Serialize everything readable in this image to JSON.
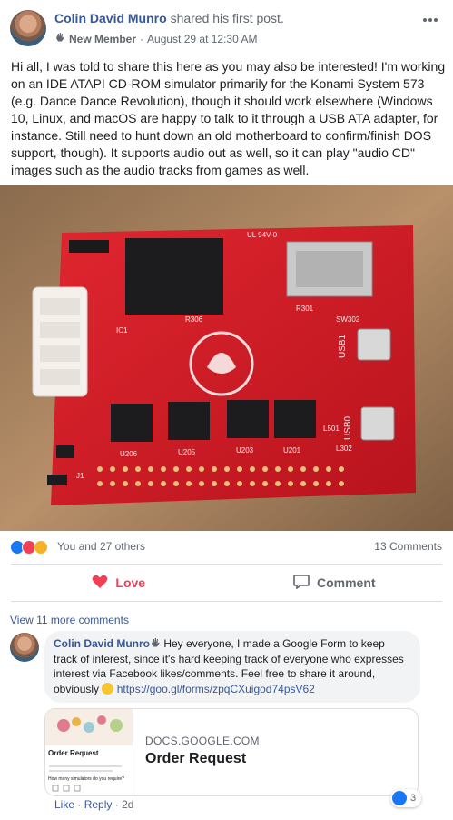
{
  "post": {
    "author": "Colin David Munro",
    "action": "shared his first post.",
    "badge": "New Member",
    "separator": "·",
    "timestamp": "August 29 at 12:30 AM",
    "text": "Hi all, I was told to share this here as you may also be interested! I'm working on an IDE ATAPI CD-ROM simulator primarily for the Konami System 573 (e.g. Dance Dance Revolution), though it should work elsewhere (Windows 10, Linux, and macOS are happy to talk to it through a USB ATA adapter, for instance. Still need to hunt down an old motherboard to confirm/finish DOS support, though). It supports audio out as well, so it can play \"audio CD\" images such as the audio tracks from games as well."
  },
  "photo": {
    "board_labels": {
      "ul": "UL 94V-0",
      "ic": "IC1",
      "sw": "SW302",
      "r301": "R301",
      "r306": "R306",
      "usb1": "USB1",
      "usb0": "USB0",
      "u206": "U206",
      "u205": "U205",
      "u203": "U203",
      "u201": "U201",
      "j1": "J1",
      "l501": "L501",
      "l302": "L302"
    }
  },
  "reactions": {
    "summary": "You and 27 others",
    "comments_count": "13 Comments"
  },
  "actions": {
    "love_label": "Love",
    "comment_label": "Comment"
  },
  "comments": {
    "view_more": "View 11 more comments",
    "items": [
      {
        "author": "Colin David Munro",
        "text": "Hey everyone, I made a Google Form to keep track of interest, since it's hard keeping track of everyone who expresses interest via Facebook likes/comments. Feel free to share it around, obviously",
        "link": "https://goo.gl/forms/zpqCXuigod74psV62",
        "card": {
          "domain": "DOCS.GOOGLE.COM",
          "title": "Order Request",
          "thumb_heading": "Order Request",
          "thumb_question": "How many simulators do you require?"
        },
        "like_label": "Like",
        "reply_label": "Reply",
        "age": "2d",
        "like_count": "3"
      }
    ]
  },
  "icons": {
    "author_badge": "wave-hand-icon",
    "more": "more-options-icon",
    "love": "heart-icon",
    "comment": "comment-bubble-icon",
    "smile": "smile-emoji-icon"
  },
  "colors": {
    "link": "#385898",
    "love": "#f33e58",
    "like": "#1877f2",
    "pcb_red": "#d8202a"
  }
}
